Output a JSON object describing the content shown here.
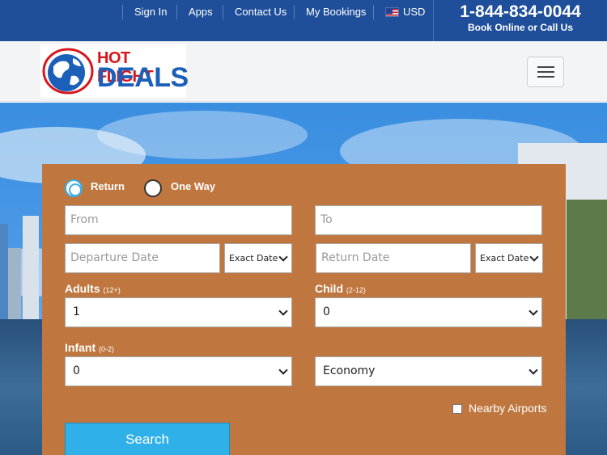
{
  "topbar": {
    "sign_in": "Sign In",
    "apps": "Apps",
    "contact_us": "Contact Us",
    "my_bookings": "My Bookings",
    "currency": "USD",
    "phone": "1-844-834-0044",
    "phone_sub": "Book Online or Call Us"
  },
  "header": {
    "logo_line1": "HOT FLIGHT",
    "logo_line2": "DEALS"
  },
  "search": {
    "trip_types": [
      {
        "label": "Return",
        "selected": true
      },
      {
        "label": "One Way",
        "selected": false
      }
    ],
    "from_placeholder": "From",
    "to_placeholder": "To",
    "departure_placeholder": "Departure Date",
    "return_placeholder": "Return Date",
    "date_mode_departure": "Exact Date",
    "date_mode_return": "Exact Date",
    "adults_label": "Adults",
    "adults_hint": "(12+)",
    "adults_value": "1",
    "child_label": "Child",
    "child_hint": "(2-12)",
    "child_value": "0",
    "infant_label": "Infant",
    "infant_hint": "(0-2)",
    "infant_value": "0",
    "cabin_value": "Economy",
    "nearby_airports_label": "Nearby Airports",
    "nearby_airports_checked": false,
    "search_button": "Search"
  },
  "colors": {
    "topbar": "#1f4f9a",
    "panel": "#bf773f",
    "search_button": "#2fb0e8",
    "logo_red": "#d8161e",
    "logo_blue": "#1b5fb8"
  }
}
